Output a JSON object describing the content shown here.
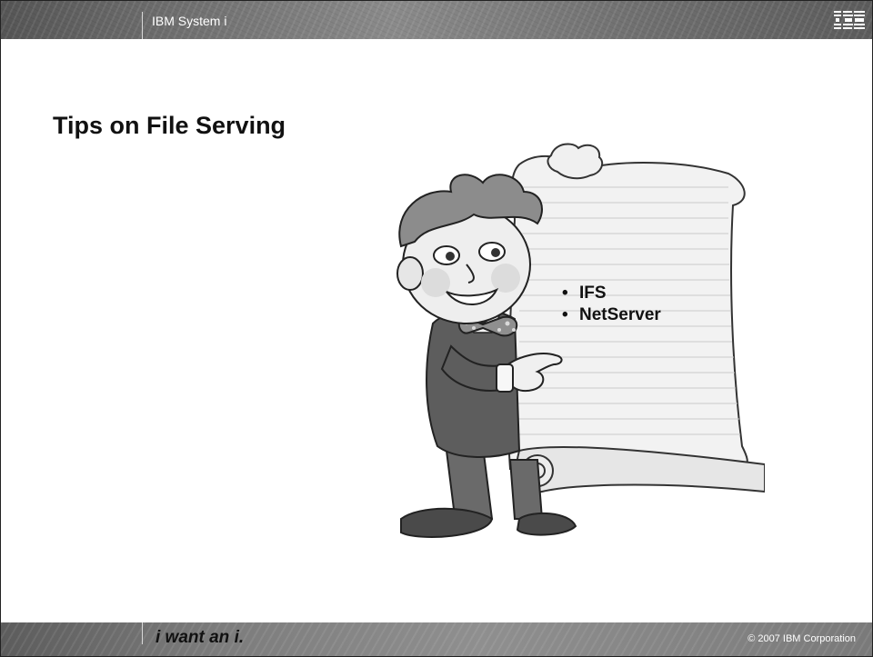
{
  "header": {
    "product_name": "IBM System i",
    "logo_icon": "ibm-logo-icon"
  },
  "slide": {
    "title": "Tips on File Serving",
    "bullets": [
      "IFS",
      "NetServer"
    ],
    "illustration_icon": "cartoon-boy-with-scroll-icon"
  },
  "footer": {
    "tagline": "i want an i.",
    "copyright": "© 2007 IBM Corporation"
  }
}
